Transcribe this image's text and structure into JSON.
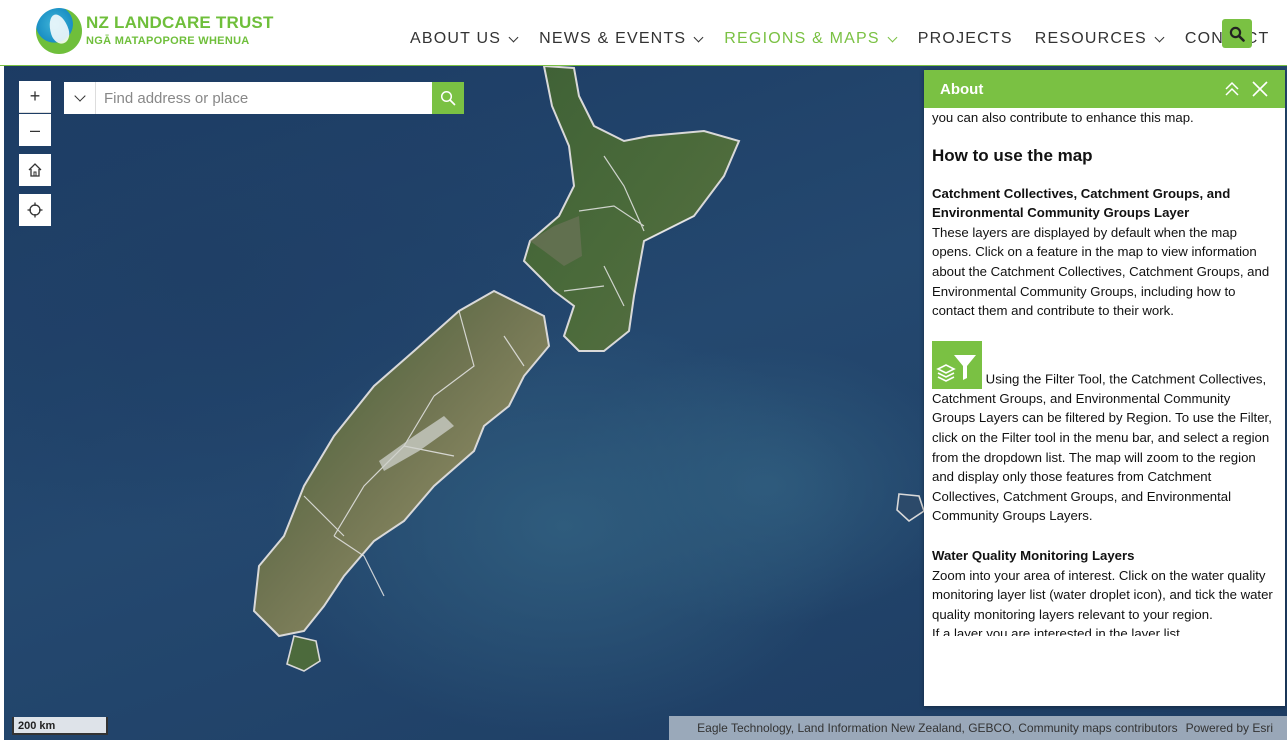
{
  "header": {
    "logo_title": "NZ LANDCARE TRUST",
    "logo_subtitle": "NGĀ MATAPOPORE WHENUA",
    "nav": [
      {
        "label": "ABOUT US",
        "dropdown": true,
        "active": false
      },
      {
        "label": "NEWS & EVENTS",
        "dropdown": true,
        "active": false
      },
      {
        "label": "REGIONS & MAPS",
        "dropdown": true,
        "active": true
      },
      {
        "label": "PROJECTS",
        "dropdown": false,
        "active": false
      },
      {
        "label": "RESOURCES",
        "dropdown": true,
        "active": false
      },
      {
        "label": "CONTACT",
        "dropdown": false,
        "active": false
      }
    ],
    "search_icon": "search-icon"
  },
  "map": {
    "controls": {
      "zoom_in": "+",
      "zoom_out": "–",
      "home_icon": "home-icon",
      "locate_icon": "locate-icon"
    },
    "search": {
      "placeholder": "Find address or place",
      "value": ""
    },
    "scale_label": "200 km",
    "attribution": "Eagle Technology, Land Information New Zealand, GEBCO, Community maps contributors",
    "powered_by": "Powered by Esri"
  },
  "panel": {
    "title": "About",
    "intro": "you can also contribute to enhance this map.",
    "heading": "How to use the map",
    "section1_title": "Catchment Collectives, Catchment Groups, and Environmental Community Groups Layer",
    "section1_text": "These layers are displayed by default when the map opens. Click on a feature in the map to view information about the Catchment Collectives, Catchment Groups, and Environmental Community Groups, including how to contact them and contribute to their work.",
    "filter_text": "Using the Filter Tool, the Catchment Collectives, Catchment Groups, and Environmental Community Groups Layers can be  filtered by Region. To use the Filter, click on the Filter tool in the menu bar, and select a region from the dropdown list. The map will zoom to the region and display only those features from Catchment Collectives, Catchment Groups, and Environmental Community Groups Layers.",
    "section2_title": "Water Quality Monitoring Layers",
    "section2_text": "Zoom into your area of interest. Click on the water quality monitoring layer list (water droplet icon), and tick the water quality monitoring layers relevant to your region.",
    "cutoff_text": "If a layer you are interested in the layer list..."
  },
  "colors": {
    "brand_green": "#7ac143",
    "ocean": "#1f3f66",
    "land_dark": "#3d5e32",
    "land_light": "#8f8f6a"
  }
}
